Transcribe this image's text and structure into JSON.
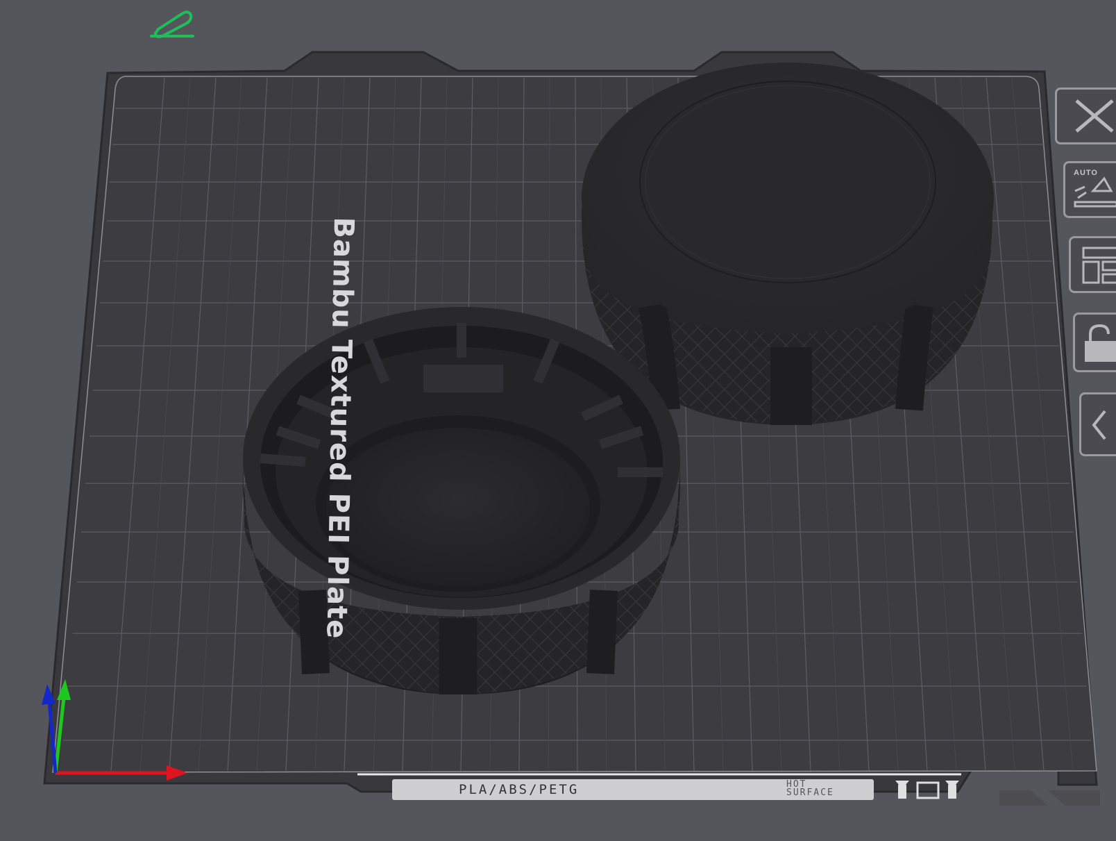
{
  "plate": {
    "name": "Bambu Textured PEI Plate",
    "material_strip": "PLA/ABS/PETG",
    "hot_surface": [
      "HOT",
      "SURFACE"
    ]
  },
  "toolbar": {
    "edit_icon": "pencil-icon",
    "side_buttons": [
      "close-icon",
      "auto-orient-icon",
      "arrange-icon",
      "lock-icon",
      "collapse-icon"
    ],
    "auto_label": "AUTO"
  },
  "axes": {
    "x_color": "#e0141e",
    "y_color": "#1ec81e",
    "z_color": "#1428c8"
  },
  "objects": [
    "knurled-cap-open",
    "knurled-cap-closed"
  ]
}
